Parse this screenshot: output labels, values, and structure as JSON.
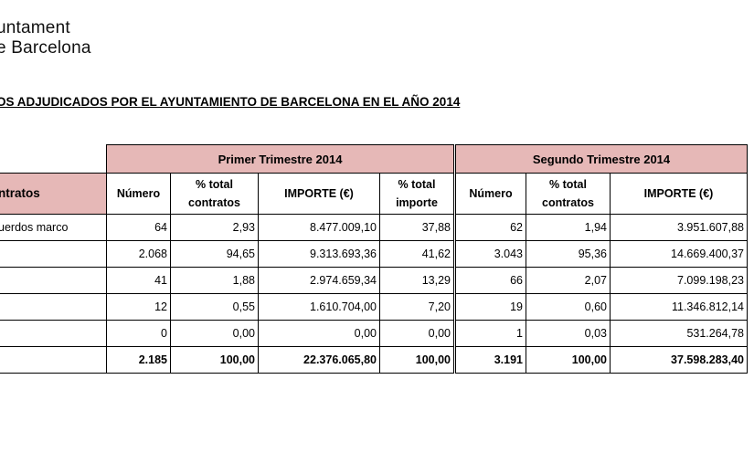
{
  "logo": {
    "line1": "untament",
    "line2": "e Barcelona"
  },
  "document_title": "OS ADJUDICADOS POR EL AYUNTAMIENTO DE BARCELONA EN EL AÑO 2014",
  "table": {
    "quarter1": "Primer Trimestre 2014",
    "quarter2": "Segundo Trimestre 2014",
    "type_header": "ntratos",
    "col_numero": "Número",
    "col_pct_contratos_1": "% total",
    "col_pct_contratos_2": "contratos",
    "col_importe": "IMPORTE  (€)",
    "col_pct_importe_1": "% total",
    "col_pct_importe_2": "importe",
    "rows": [
      {
        "label": "uerdos marco",
        "q1": [
          "64",
          "2,93",
          "8.477.009,10",
          "37,88"
        ],
        "q2": [
          "62",
          "1,94",
          "3.951.607,88"
        ]
      },
      {
        "label": "",
        "q1": [
          "2.068",
          "94,65",
          "9.313.693,36",
          "41,62"
        ],
        "q2": [
          "3.043",
          "95,36",
          "14.669.400,37"
        ]
      },
      {
        "label": "",
        "q1": [
          "41",
          "1,88",
          "2.974.659,34",
          "13,29"
        ],
        "q2": [
          "66",
          "2,07",
          "7.099.198,23"
        ]
      },
      {
        "label": "",
        "q1": [
          "12",
          "0,55",
          "1.610.704,00",
          "7,20"
        ],
        "q2": [
          "19",
          "0,60",
          "11.346.812,14"
        ]
      },
      {
        "label": "",
        "q1": [
          "0",
          "0,00",
          "0,00",
          "0,00"
        ],
        "q2": [
          "1",
          "0,03",
          "531.264,78"
        ]
      }
    ],
    "total": {
      "q1": [
        "2.185",
        "100,00",
        "22.376.065,80",
        "100,00"
      ],
      "q2": [
        "3.191",
        "100,00",
        "37.598.283,40"
      ]
    }
  }
}
